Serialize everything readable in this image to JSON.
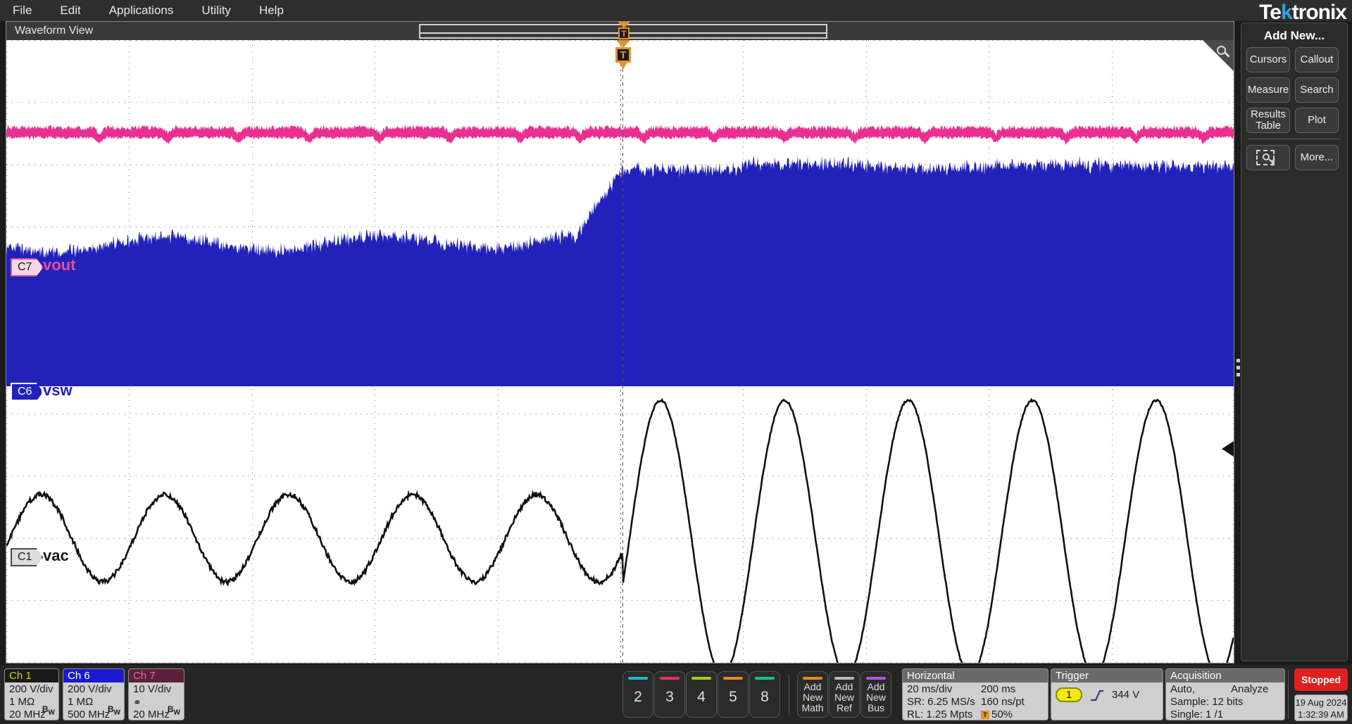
{
  "menubar": {
    "items": [
      {
        "label": "File"
      },
      {
        "label": "Edit"
      },
      {
        "label": "Applications"
      },
      {
        "label": "Utility"
      },
      {
        "label": "Help"
      }
    ]
  },
  "brand": {
    "name_pre": "Te",
    "name_k": "k",
    "name_post": "tronix"
  },
  "waveform_view": {
    "title": "Waveform View",
    "trigger_marker": "T",
    "zoom_overview_marker": "T",
    "channels": [
      {
        "badge": "C7",
        "label": "vout",
        "color": "#ea4d9c"
      },
      {
        "badge": "C6",
        "label": "vsw",
        "color": "#2222bb"
      },
      {
        "badge": "C1",
        "label": "vac",
        "color": "#111111"
      }
    ]
  },
  "channel_badges": [
    {
      "name": "Ch 1",
      "scale": "200 V/div",
      "impedance": "1 MΩ",
      "bandwidth": "20 MHz",
      "bw_mark": "B",
      "bw_sub": "W",
      "head_bg": "#1a1a1a",
      "head_fg": "#d6d400"
    },
    {
      "name": "Ch 6",
      "scale": "200 V/div",
      "impedance": "1 MΩ",
      "bandwidth": "500 MHz",
      "bw_mark": "B",
      "bw_sub": "W",
      "head_bg": "#1b1bd1",
      "head_fg": "#ffffff"
    },
    {
      "name": "Ch 7",
      "scale": "10 V/div",
      "impedance": "probe-icon",
      "bandwidth": "20 MHz",
      "bw_mark": "B",
      "bw_sub": "W",
      "head_bg": "#5c1f3d",
      "head_fg": "#e06ba6"
    }
  ],
  "channel_buttons": [
    {
      "label": "2",
      "color": "#22b8c8"
    },
    {
      "label": "3",
      "color": "#e0385a"
    },
    {
      "label": "4",
      "color": "#9ed018"
    },
    {
      "label": "5",
      "color": "#e08a22"
    },
    {
      "label": "8",
      "color": "#15c48a"
    }
  ],
  "add_buttons": [
    {
      "line1": "Add",
      "line2": "New",
      "line3": "Math",
      "color": "#e08a22"
    },
    {
      "line1": "Add",
      "line2": "New",
      "line3": "Ref",
      "color": "#b8b8b8"
    },
    {
      "line1": "Add",
      "line2": "New",
      "line3": "Bus",
      "color": "#b457e0"
    }
  ],
  "horizontal": {
    "title": "Horizontal",
    "scale": "20 ms/div",
    "duration": "200 ms",
    "sample_rate": "SR: 6.25 MS/s",
    "resolution": "160 ns/pt",
    "record_length": "RL: 1.25 Mpts",
    "position": "50%",
    "position_icon": "T"
  },
  "trigger": {
    "title": "Trigger",
    "source": "1",
    "slope_icon": "rising-edge-icon",
    "level": "344 V"
  },
  "acquisition": {
    "title": "Acquisition",
    "mode": "Auto,",
    "analyze": "Analyze",
    "sample": "Sample: 12 bits",
    "single": "Single: 1 /1"
  },
  "status": {
    "run_state": "Stopped",
    "date": "19 Aug 2024",
    "time": "1:32:39 AM",
    "run_color": "#e02020"
  },
  "sidebar": {
    "title": "Add New...",
    "buttons": [
      {
        "label": "Cursors"
      },
      {
        "label": "Callout"
      },
      {
        "label": "Measure"
      },
      {
        "label": "Search"
      },
      {
        "label": "Results Table"
      },
      {
        "label": "Plot"
      }
    ],
    "zoom_button": "zoom-select-icon",
    "more_button": "More..."
  }
}
